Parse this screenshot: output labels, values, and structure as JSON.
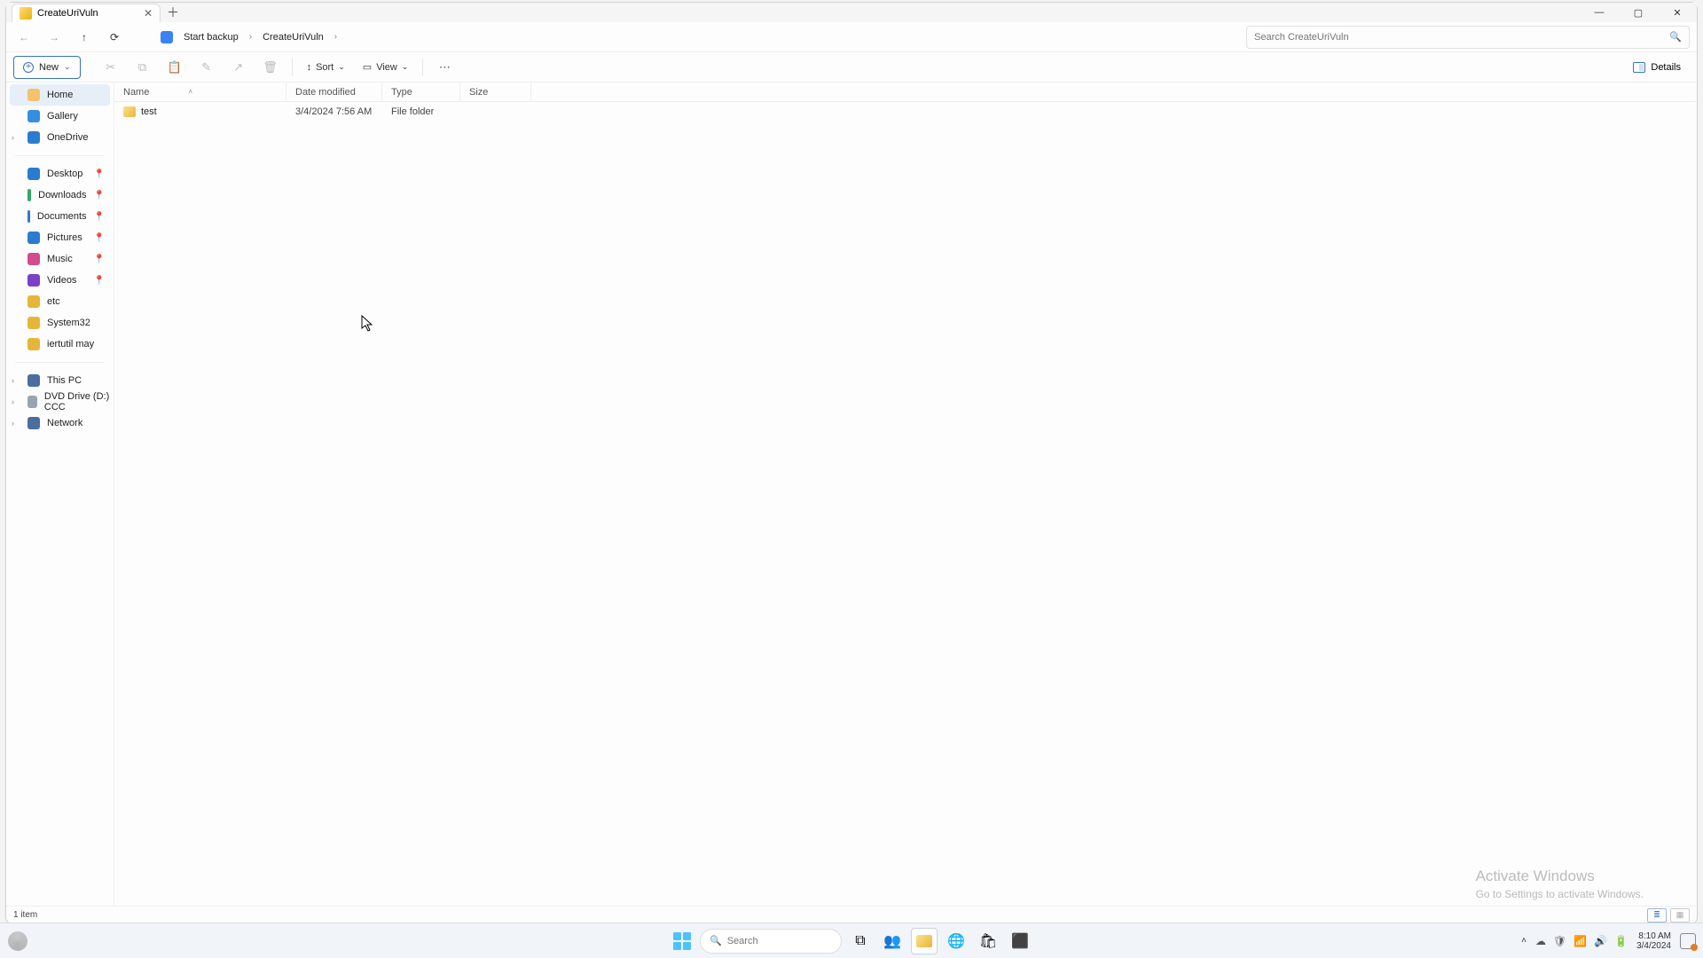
{
  "window": {
    "tab_title": "CreateUriVuln",
    "minimize_glyph": "—",
    "maximize_glyph": "▢",
    "close_glyph": "✕",
    "newtab_glyph": "＋"
  },
  "nav": {
    "back_glyph": "←",
    "fwd_glyph": "→",
    "up_glyph": "↑",
    "refresh_glyph": "⟳",
    "breadcrumb_root": "Start backup",
    "breadcrumb_current": "CreateUriVuln",
    "chevron": "›",
    "search_placeholder": "Search CreateUriVuln",
    "search_glyph": "🔍"
  },
  "toolbar": {
    "new_label": "New",
    "new_dropdown": "⌄",
    "cut_glyph": "✂",
    "copy_glyph": "⧉",
    "paste_glyph": "📋",
    "rename_glyph": "✎",
    "share_glyph": "↗",
    "delete_glyph": "🗑",
    "sort_label": "Sort",
    "sort_glyph": "↕",
    "view_label": "View",
    "view_glyph": "▭",
    "more_glyph": "⋯",
    "details_label": "Details"
  },
  "columns": {
    "name": "Name",
    "date": "Date modified",
    "type": "Type",
    "size": "Size",
    "sort_indicator": "˄"
  },
  "rows": [
    {
      "name": "test",
      "date": "3/4/2024 7:56 AM",
      "type": "File folder",
      "size": ""
    }
  ],
  "sidebar": {
    "home": "Home",
    "gallery": "Gallery",
    "onedrive": "OneDrive",
    "desktop": "Desktop",
    "downloads": "Downloads",
    "documents": "Documents",
    "pictures": "Pictures",
    "music": "Music",
    "videos": "Videos",
    "etc": "etc",
    "system32": "System32",
    "iertutil": "iertutil may",
    "thispc": "This PC",
    "dvd": "DVD Drive (D:) CCC",
    "network": "Network",
    "pin_glyph": "📌"
  },
  "status": {
    "count": "1 item"
  },
  "watermark": {
    "line1": "Activate Windows",
    "line2": "Go to Settings to activate Windows."
  },
  "taskbar": {
    "search_placeholder": "Search",
    "clock_time": "8:10 AM",
    "clock_date": "3/4/2024",
    "tray_up": "˄",
    "wifi_glyph": "📶",
    "sound_glyph": "🔊",
    "battery_glyph": "🔋",
    "cloud_glyph": "☁"
  }
}
